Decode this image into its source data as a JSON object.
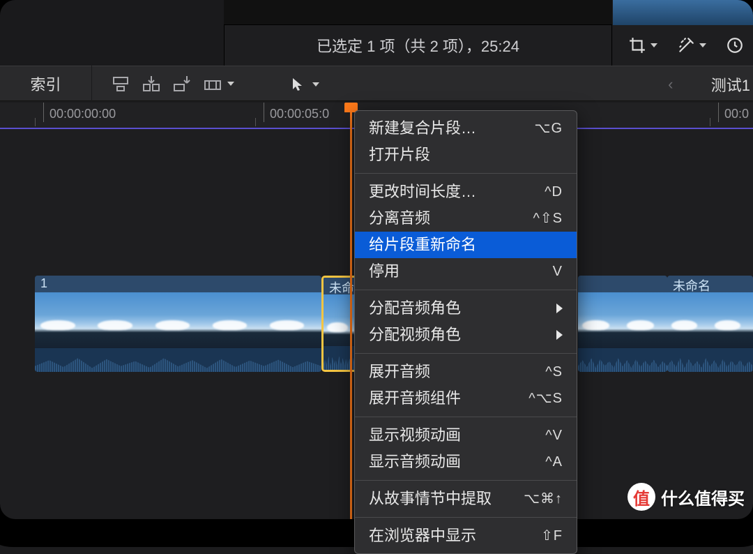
{
  "status": {
    "text": "已选定 1 项（共 2 项），25:24"
  },
  "toolbar": {
    "index_label": "索引",
    "project_title": "测试1"
  },
  "ruler": {
    "ticks": [
      "00:00:00:00",
      "00:00:05:0",
      "00:0"
    ]
  },
  "clips": {
    "c1_label": "1",
    "c2_label": "未命",
    "c3_label": "",
    "c4_label": "未命名"
  },
  "context_menu": {
    "items": [
      {
        "label": "新建复合片段…",
        "shortcut": "⌥G"
      },
      {
        "label": "打开片段",
        "shortcut": ""
      },
      {
        "sep": true
      },
      {
        "label": "更改时间长度…",
        "shortcut": "^D"
      },
      {
        "label": "分离音频",
        "shortcut": "^⇧S"
      },
      {
        "label": "给片段重新命名",
        "shortcut": "",
        "highlight": true
      },
      {
        "label": "停用",
        "shortcut": "V"
      },
      {
        "sep": true
      },
      {
        "label": "分配音频角色",
        "submenu": true
      },
      {
        "label": "分配视频角色",
        "submenu": true
      },
      {
        "sep": true
      },
      {
        "label": "展开音频",
        "shortcut": "^S"
      },
      {
        "label": "展开音频组件",
        "shortcut": "^⌥S"
      },
      {
        "sep": true
      },
      {
        "label": "显示视频动画",
        "shortcut": "^V"
      },
      {
        "label": "显示音频动画",
        "shortcut": "^A"
      },
      {
        "sep": true
      },
      {
        "label": "从故事情节中提取",
        "shortcut": "⌥⌘↑"
      },
      {
        "sep": true
      },
      {
        "label": "在浏览器中显示",
        "shortcut": "⇧F",
        "cut": true
      }
    ]
  },
  "watermark": {
    "badge": "值",
    "text": "什么值得买"
  }
}
